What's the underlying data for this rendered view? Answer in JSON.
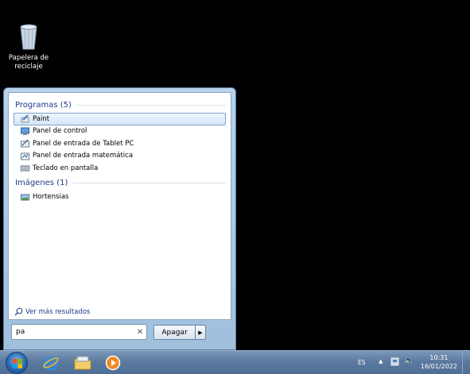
{
  "desktop": {
    "recycle_bin_label": "Papelera de reciclaje"
  },
  "start_menu": {
    "groups": [
      {
        "header": "Programas (5)",
        "items": [
          {
            "label": "Paint",
            "icon": "paint-icon",
            "selected": true
          },
          {
            "label": "Panel de control",
            "icon": "control-panel-icon"
          },
          {
            "label": "Panel de entrada de Tablet PC",
            "icon": "tablet-input-icon"
          },
          {
            "label": "Panel de entrada matemática",
            "icon": "math-input-icon"
          },
          {
            "label": "Teclado en pantalla",
            "icon": "keyboard-icon"
          }
        ]
      },
      {
        "header": "Imágenes (1)",
        "items": [
          {
            "label": "Hortensias",
            "icon": "image-icon"
          }
        ]
      }
    ],
    "see_more": "Ver más resultados",
    "search": {
      "value": "pa"
    },
    "shutdown_label": "Apagar"
  },
  "taskbar": {
    "pinned": [
      "internet-explorer-icon",
      "file-explorer-icon",
      "media-player-icon"
    ],
    "language": "ES",
    "time": "10:31",
    "date": "16/01/2022"
  },
  "colors": {
    "accent": "#1e3a8a",
    "taskbar": "#5c7aa0",
    "menu_frame": "#a9c6e2"
  }
}
